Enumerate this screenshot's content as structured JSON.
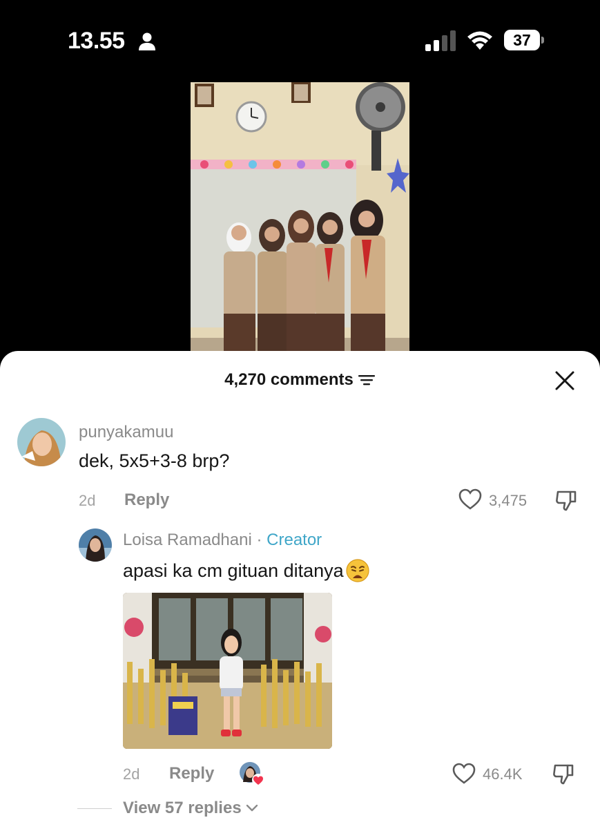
{
  "status_bar": {
    "time": "13.55",
    "battery": "37"
  },
  "sheet": {
    "comment_count": "4,270 comments"
  },
  "comments": [
    {
      "username": "punyakamuu",
      "text": "dek, 5x5+3-8 brp?",
      "time": "2d",
      "reply_label": "Reply",
      "likes": "3,475"
    }
  ],
  "reply": {
    "username": "Loisa Ramadhani",
    "separator": "·",
    "badge": "Creator",
    "text": "apasi ka cm gituan ditanya",
    "emoji": "weary-face-icon",
    "time": "2d",
    "reply_label": "Reply",
    "likes": "46.4K",
    "view_replies": "View 57 replies"
  },
  "colors": {
    "creator_accent": "#3fa6c8",
    "sheet_bg": "#ffffff",
    "text_primary": "#161616",
    "text_secondary": "#8a8a8a"
  }
}
